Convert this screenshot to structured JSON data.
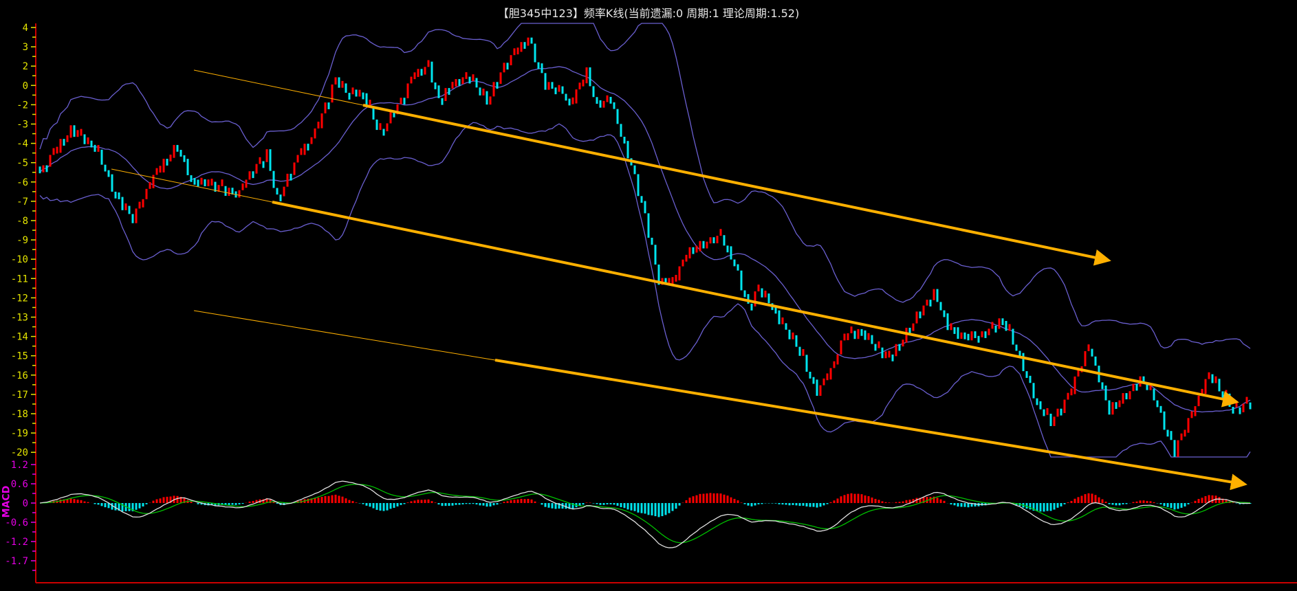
{
  "title": "【胆345中123】频率K线(当前遗漏:0 周期:1 理论周期:1.52)",
  "colors": {
    "up": "#ff0000",
    "down": "#00e5ee",
    "band": "#6a5fd0",
    "arrow": "#ffb000",
    "axis": "#cc0000",
    "tick": "#e6e600",
    "macd_label": "#e600e6",
    "dif": "#e0e0e0",
    "dea": "#00c000"
  },
  "chart_data": [
    {
      "type": "candlestick",
      "title": "【胆345中123】频率K线(当前遗漏:0 周期:1 理论周期:1.52)",
      "ytick_labels": [
        "4",
        "3",
        "2",
        "0",
        "-2",
        "-3",
        "-4",
        "-5",
        "-6",
        "-7",
        "-8",
        "-9",
        "-10",
        "-11",
        "-12",
        "-13",
        "-14",
        "-15",
        "-16",
        "-17",
        "-18",
        "-19",
        "-20"
      ],
      "ylim": [
        2,
        -20
      ],
      "candle_count": 353,
      "close_waypoints": [
        [
          0,
          -5.5
        ],
        [
          9,
          -3.4
        ],
        [
          15,
          -4.1
        ],
        [
          17,
          -4.5
        ],
        [
          22,
          -6.6
        ],
        [
          27,
          -7.9
        ],
        [
          33,
          -5.8
        ],
        [
          40,
          -4.2
        ],
        [
          44,
          -5.9
        ],
        [
          51,
          -6.2
        ],
        [
          58,
          -6.6
        ],
        [
          60,
          -5.8
        ],
        [
          66,
          -4.6
        ],
        [
          69,
          -7.0
        ],
        [
          75,
          -4.7
        ],
        [
          80,
          -3.4
        ],
        [
          86,
          -0.6
        ],
        [
          89,
          -1.3
        ],
        [
          94,
          -1.5
        ],
        [
          99,
          -3.6
        ],
        [
          102,
          -2.6
        ],
        [
          106,
          -1.5
        ],
        [
          108,
          -0.6
        ],
        [
          113,
          0.1
        ],
        [
          116,
          -1.7
        ],
        [
          120,
          -0.9
        ],
        [
          125,
          -0.6
        ],
        [
          130,
          -1.9
        ],
        [
          135,
          0.0
        ],
        [
          142,
          1.5
        ],
        [
          147,
          -0.9
        ],
        [
          152,
          -1.3
        ],
        [
          154,
          -2.1
        ],
        [
          159,
          -0.4
        ],
        [
          162,
          -2.1
        ],
        [
          166,
          -1.7
        ],
        [
          168,
          -3.0
        ],
        [
          172,
          -5.1
        ],
        [
          176,
          -7.7
        ],
        [
          180,
          -11.1
        ],
        [
          184,
          -11.3
        ],
        [
          188,
          -9.8
        ],
        [
          192,
          -9.4
        ],
        [
          198,
          -8.8
        ],
        [
          202,
          -10.2
        ],
        [
          206,
          -12.4
        ],
        [
          209,
          -11.5
        ],
        [
          213,
          -12.4
        ],
        [
          215,
          -13.2
        ],
        [
          220,
          -14.5
        ],
        [
          226,
          -16.9
        ],
        [
          230,
          -15.8
        ],
        [
          234,
          -13.9
        ],
        [
          239,
          -13.7
        ],
        [
          243,
          -14.5
        ],
        [
          246,
          -15.2
        ],
        [
          250,
          -14.5
        ],
        [
          255,
          -13.0
        ],
        [
          260,
          -11.7
        ],
        [
          264,
          -13.4
        ],
        [
          268,
          -13.9
        ],
        [
          274,
          -13.9
        ],
        [
          280,
          -13.2
        ],
        [
          284,
          -14.7
        ],
        [
          290,
          -17.5
        ],
        [
          294,
          -18.4
        ],
        [
          299,
          -17.1
        ],
        [
          305,
          -14.5
        ],
        [
          311,
          -17.9
        ],
        [
          316,
          -17.1
        ],
        [
          320,
          -16.2
        ],
        [
          324,
          -17.1
        ],
        [
          330,
          -19.9
        ],
        [
          334,
          -18.4
        ],
        [
          340,
          -16.0
        ],
        [
          345,
          -17.3
        ],
        [
          348,
          -17.9
        ],
        [
          352,
          -17.3
        ]
      ],
      "indicators": [
        "Bollinger Bands (20, 2)"
      ]
    },
    {
      "type": "macd",
      "name": "MACD",
      "ytick_labels": [
        "1.2",
        "0.6",
        "0",
        "-0.6",
        "-1.2",
        "-1.7"
      ],
      "series": [
        "DIF",
        "DEA",
        "MACD histogram"
      ]
    }
  ]
}
